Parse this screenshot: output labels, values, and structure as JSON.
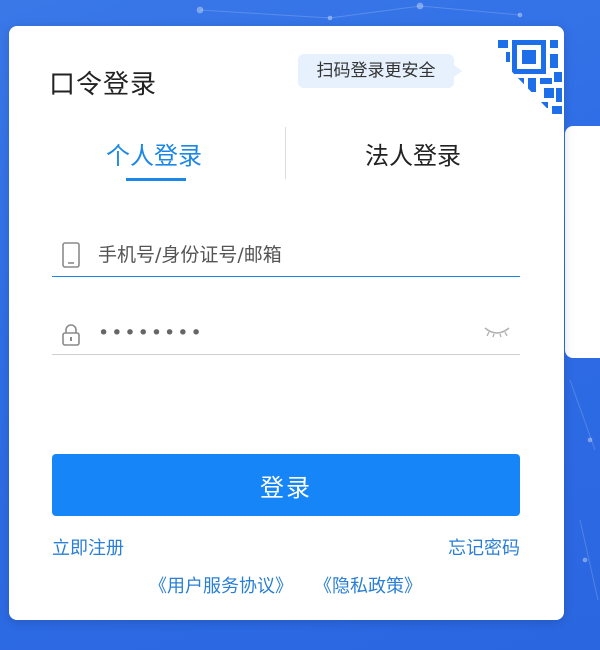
{
  "card": {
    "title": "口令登录",
    "qr_tip": "扫码登录更安全"
  },
  "tabs": [
    {
      "label": "个人登录",
      "active": true
    },
    {
      "label": "法人登录",
      "active": false
    }
  ],
  "account": {
    "placeholder": "手机号/身份证号/邮箱",
    "value": ""
  },
  "password": {
    "placeholder": "",
    "value": "••••••••"
  },
  "actions": {
    "login_label": "登录",
    "register_label": "立即注册",
    "forgot_label": "忘记密码",
    "terms_label": "《用户服务协议》",
    "privacy_label": "《隐私政策》"
  },
  "colors": {
    "accent": "#1685f8",
    "link": "#2a7fd4",
    "background": "#2f6ee6"
  },
  "icons": {
    "qr": "qr-code-icon",
    "phone": "phone-icon",
    "lock": "lock-icon",
    "eye": "eye-closed-icon"
  }
}
